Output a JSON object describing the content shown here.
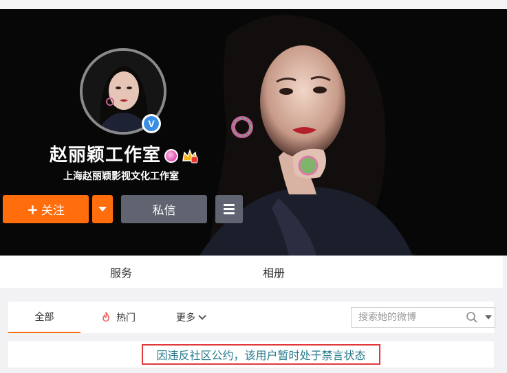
{
  "profile": {
    "name": "赵丽颖工作室",
    "subtitle": "上海赵丽颖影视文化工作室",
    "verified_icon": "verified-v-icon",
    "badges": [
      "pink-member-badge-icon",
      "vip-crown-badge-icon"
    ]
  },
  "actions": {
    "follow_plus": "+",
    "follow_label": "关注",
    "message_label": "私信",
    "menu_icon": "hamburger-menu-icon"
  },
  "subnav": {
    "items": [
      {
        "label": "服务"
      },
      {
        "label": "相册"
      }
    ]
  },
  "tabs": {
    "all": "全部",
    "hot": "热门",
    "more": "更多"
  },
  "search": {
    "placeholder": "搜索她的微博"
  },
  "notice": {
    "text": "因违反社区公约，该用户暂时处于禁言状态"
  },
  "colors": {
    "accent_orange": "#ff6d0c",
    "button_gray": "#5f6470",
    "notice_border": "#e0383b",
    "notice_text": "#277a8c"
  }
}
